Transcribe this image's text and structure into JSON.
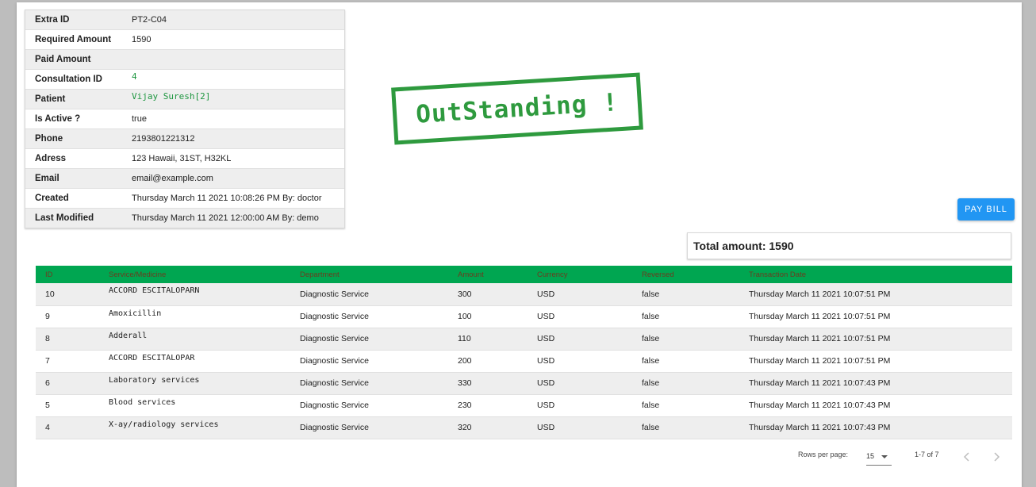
{
  "info": [
    {
      "label": "Extra ID",
      "value": "PT2-C04"
    },
    {
      "label": "Required Amount",
      "value": "1590"
    },
    {
      "label": "Paid Amount",
      "value": ""
    },
    {
      "label": "Consultation ID",
      "value": "4"
    },
    {
      "label": "Patient",
      "value": "Vijay Suresh[2]"
    },
    {
      "label": "Is Active ?",
      "value": "true"
    },
    {
      "label": "Phone",
      "value": "2193801221312"
    },
    {
      "label": "Adress",
      "value": "123 Hawaii, 31ST, H32KL"
    },
    {
      "label": "Email",
      "value": "email@example.com"
    },
    {
      "label": "Created",
      "value": "Thursday March 11 2021 10:08:26 PM By: doctor"
    },
    {
      "label": "Last Modified",
      "value": "Thursday March 11 2021 12:00:00 AM By: demo"
    }
  ],
  "stamp": "OutStanding !",
  "pay_button": "PAY BILL",
  "total": "Total amount: 1590",
  "table": {
    "headers": [
      "ID",
      "Service/Medicine",
      "Department",
      "Amount",
      "Currency",
      "Reversed",
      "Transaction Date"
    ],
    "rows": [
      [
        "10",
        "ACCORD ESCITALOPARN",
        "Diagnostic Service",
        "300",
        "USD",
        "false",
        "Thursday March 11 2021 10:07:51 PM"
      ],
      [
        "9",
        "Amoxicillin",
        "Diagnostic Service",
        "100",
        "USD",
        "false",
        "Thursday March 11 2021 10:07:51 PM"
      ],
      [
        "8",
        "Adderall",
        "Diagnostic Service",
        "110",
        "USD",
        "false",
        "Thursday March 11 2021 10:07:51 PM"
      ],
      [
        "7",
        "ACCORD ESCITALOPAR",
        "Diagnostic Service",
        "200",
        "USD",
        "false",
        "Thursday March 11 2021 10:07:51 PM"
      ],
      [
        "6",
        "Laboratory services",
        "Diagnostic Service",
        "330",
        "USD",
        "false",
        "Thursday March 11 2021 10:07:43 PM"
      ],
      [
        "5",
        "Blood services",
        "Diagnostic Service",
        "230",
        "USD",
        "false",
        "Thursday March 11 2021 10:07:43 PM"
      ],
      [
        "4",
        "X-ay/radiology services",
        "Diagnostic Service",
        "320",
        "USD",
        "false",
        "Thursday March 11 2021 10:07:43 PM"
      ]
    ]
  },
  "pagination": {
    "rows_per_page_label": "Rows per page:",
    "rows_per_page": "15",
    "range": "1-7 of 7"
  },
  "colors": {
    "header_green": "#00a651",
    "stamp_green": "#2e9a3e",
    "button_blue": "#2196f3"
  }
}
